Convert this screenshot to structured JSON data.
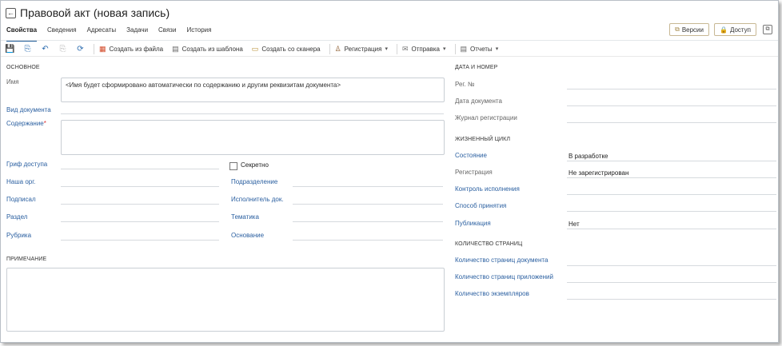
{
  "window": {
    "title": "Правовой акт (новая запись)"
  },
  "tabs": [
    "Свойства",
    "Сведения",
    "Адресаты",
    "Задачи",
    "Связи",
    "История"
  ],
  "header_buttons": {
    "versions": "Версии",
    "access": "Доступ"
  },
  "toolbar": {
    "create_from_file": "Создать из файла",
    "create_from_template": "Создать из шаблона",
    "create_from_scanner": "Создать со сканера",
    "registration": "Регистрация",
    "sending": "Отправка",
    "reports": "Отчеты"
  },
  "left": {
    "section_main": "ОСНОВНОЕ",
    "name_label": "Имя",
    "name_value": "<Имя будет сформировано автоматически по содержанию и другим реквизитам документа>",
    "doc_type_label": "Вид документа",
    "content_label": "Содержание",
    "content_required": "*",
    "access_label": "Гриф доступа",
    "secret_label": "Секретно",
    "our_org_label": "Наша орг.",
    "department_label": "Подразделение",
    "signed_label": "Подписал",
    "executor_label": "Исполнитель док.",
    "section_label": "Раздел",
    "topic_label": "Тематика",
    "rubric_label": "Рубрика",
    "basis_label": "Основание",
    "section_note": "ПРИМЕЧАНИЕ"
  },
  "right": {
    "section_date": "ДАТА И НОМЕР",
    "reg_no_label": "Рег. №",
    "doc_date_label": "Дата документа",
    "journal_label": "Журнал регистрации",
    "section_lifecycle": "ЖИЗНЕННЫЙ ЦИКЛ",
    "state_label": "Состояние",
    "state_value": "В разработке",
    "registration_label": "Регистрация",
    "registration_value": "Не зарегистрирован",
    "control_label": "Контроль исполнения",
    "adoption_label": "Способ принятия",
    "publication_label": "Публикация",
    "publication_value": "Нет",
    "section_pages": "КОЛИЧЕСТВО СТРАНИЦ",
    "doc_pages_label": "Количество страниц документа",
    "app_pages_label": "Количество страниц приложений",
    "copies_label": "Количество экземпляров"
  },
  "colors": {
    "link": "#2a5fa0",
    "accent": "#1e5a96",
    "required": "#d33333"
  }
}
